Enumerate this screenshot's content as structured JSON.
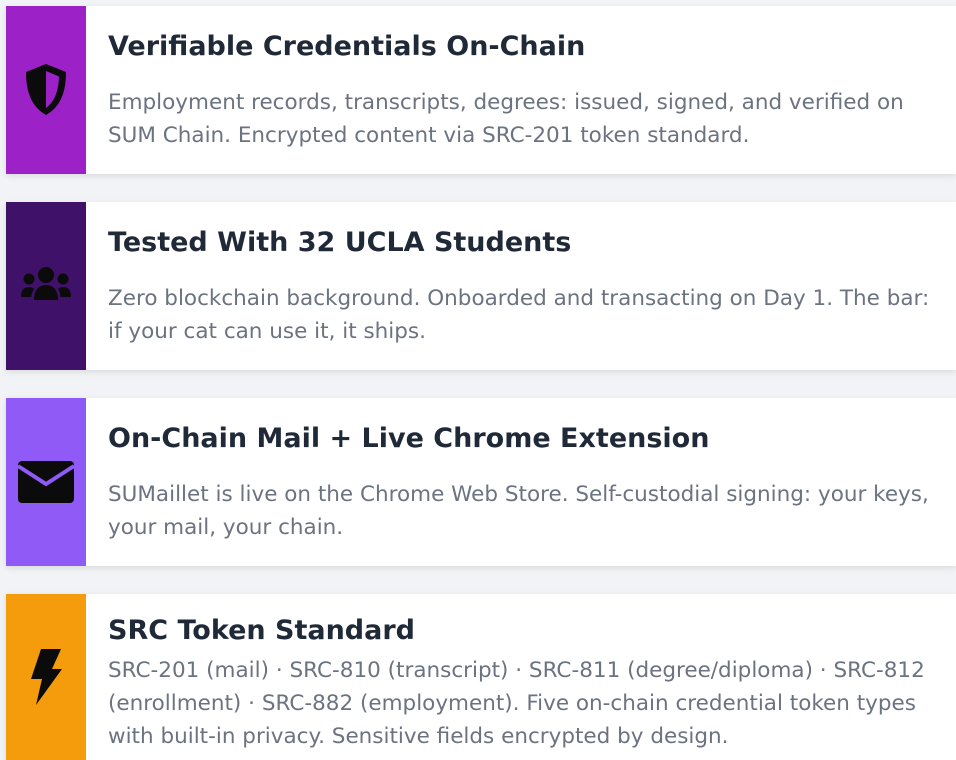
{
  "cards": [
    {
      "title": "Verifiable Credentials On-Chain",
      "description": "Employment records, transcripts, degrees: issued, signed, and verified on SUM Chain. Encrypted content via SRC-201 token standard.",
      "icon": "shield-icon",
      "accent": "#9c22c8"
    },
    {
      "title": "Tested With 32 UCLA Students",
      "description": "Zero blockchain background. Onboarded and transacting on Day 1. The bar: if your cat can use it, it ships.",
      "icon": "users-icon",
      "accent": "#3f1169"
    },
    {
      "title": "On-Chain Mail + Live Chrome Extension",
      "description": "SUMaillet is live on the Chrome Web Store. Self-custodial signing: your keys, your mail, your chain.",
      "icon": "envelope-icon",
      "accent": "#8f5af5"
    },
    {
      "title": "SRC Token Standard",
      "description": "SRC-201 (mail) · SRC-810 (transcript) · SRC-811 (degree/diploma) · SRC-812 (enrollment) · SRC-882 (employment). Five on-chain credential token types with built-in privacy. Sensitive fields encrypted by design.",
      "icon": "bolt-icon",
      "accent": "#f49c0b"
    }
  ]
}
